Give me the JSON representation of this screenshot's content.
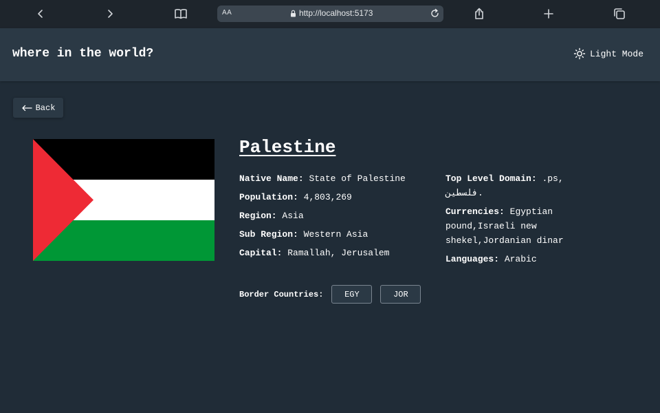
{
  "browser": {
    "url_aa": "AA",
    "url": "http://localhost:5173"
  },
  "header": {
    "title": "where in the world?",
    "mode_label": "Light Mode"
  },
  "back_label": "Back",
  "country": {
    "name": "Palestine",
    "left": [
      {
        "label": "Native Name:",
        "value": "State of Palestine"
      },
      {
        "label": "Population:",
        "value": "4,803,269"
      },
      {
        "label": "Region:",
        "value": "Asia"
      },
      {
        "label": "Sub Region:",
        "value": "Western Asia"
      },
      {
        "label": "Capital:",
        "value": "Ramallah, Jerusalem"
      }
    ],
    "right": [
      {
        "label": "Top Level Domain:",
        "value": ".ps, فلسطين."
      },
      {
        "label": "Currencies:",
        "value": "Egyptian pound,Israeli new shekel,Jordanian dinar"
      },
      {
        "label": "Languages:",
        "value": "Arabic"
      }
    ],
    "borders_label": "Border Countries:",
    "borders": [
      "EGY",
      "JOR"
    ]
  },
  "colors": {
    "background": "#202c37",
    "elements": "#2b3945",
    "flag_black": "#000000",
    "flag_white": "#ffffff",
    "flag_green": "#009736",
    "flag_red": "#ee2a35"
  }
}
